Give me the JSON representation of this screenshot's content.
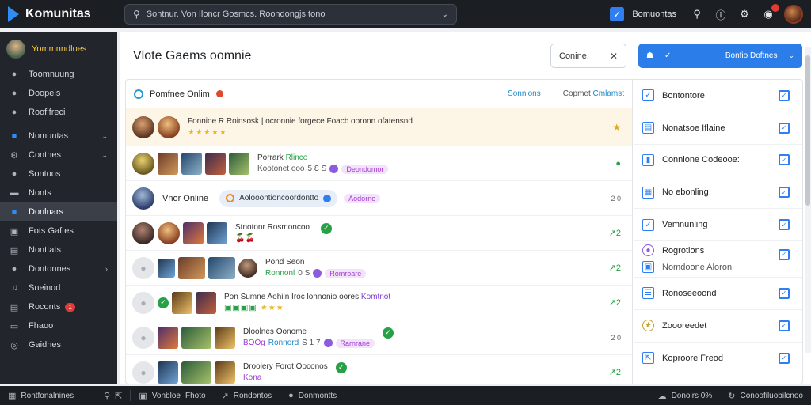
{
  "app": {
    "name": "Komunitas"
  },
  "search": {
    "text": "Sontnur. Von Iloncr Gosmcs. Roondongjs tono"
  },
  "topbar": {
    "checkbox_label": "Bomuontas"
  },
  "sidebar": {
    "user": "Yommnndloes",
    "items": [
      {
        "label": "Toomnuung",
        "icon": "home-icon"
      },
      {
        "label": "Doopeis",
        "icon": "chat-icon"
      },
      {
        "label": "Roofifreci",
        "icon": "person-icon"
      },
      {
        "label": "Nomuntas",
        "icon": "community-icon",
        "chevron": true,
        "accent": true
      },
      {
        "label": "Contnes",
        "icon": "gear-icon",
        "chevron": true
      },
      {
        "label": "Sontoos",
        "icon": "wrench-icon"
      },
      {
        "label": "Nonts",
        "icon": "notes-icon"
      },
      {
        "label": "Donlnars",
        "icon": "group-icon",
        "active": true
      },
      {
        "label": "Fots Gaftes",
        "icon": "image-icon"
      },
      {
        "label": "Nonttats",
        "icon": "doc-icon"
      },
      {
        "label": "Dontonnes",
        "icon": "phone-icon",
        "chevron": true
      },
      {
        "label": "Sneinod",
        "icon": "music-icon"
      },
      {
        "label": "Roconts",
        "icon": "folder-icon",
        "badge": "1"
      },
      {
        "label": "Fhaoo",
        "icon": "card-icon"
      },
      {
        "label": "Gaidnes",
        "icon": "compass-icon"
      }
    ]
  },
  "main": {
    "title": "Vlote Gaems oomnie",
    "filter": {
      "value": "Conine."
    },
    "primary_button": {
      "label": "Bonfio Doftnes"
    },
    "panel": {
      "title": "Pomfnee Onlim",
      "tab_1": "Sonnions",
      "tab_2_prefix": "Copmet",
      "tab_2_suffix": "Cmlamst"
    },
    "rows": [
      {
        "line1": "Fonnioe R Roinsosk | ocronnie forgece Foacb ooronn ofatensnd",
        "stars": "★★★★★",
        "right": "★"
      },
      {
        "line1": "Porrark",
        "line1_green": "Rlinco",
        "line2": "Kootonet ooo",
        "line2_num": "5 Ɛ S",
        "pill": "Deondomor",
        "right": "●"
      },
      {
        "name": "Vnor Online",
        "status": "Aolooontioncoordontto",
        "pill": "Aodorne",
        "right": "2 0"
      },
      {
        "line1": "Stnotonr Rosmoncoo",
        "line2": "🍒🍒",
        "right": "↗2"
      },
      {
        "line1": "Pond Seon",
        "line2": "Ronnonl",
        "line2_num": "0 S",
        "pill": "Romroare",
        "right": "↗2"
      },
      {
        "line1": "Pon Sumne  Aohiln Iroc lonnonio oores",
        "line1_purple": "Komtnot",
        "line2": "▣▣▣▣",
        "stars": "★★★",
        "right": "↗2"
      },
      {
        "line1": "Dloolnes Oonome",
        "line2": "BOOg",
        "line2_link": "Ronnord",
        "line2_num": "S 1 7",
        "pill": "Rarnrane",
        "right": "2 0"
      },
      {
        "line1": "Droolery  Forot Ooconos",
        "line2": "Kona",
        "right": "↗2"
      }
    ],
    "right_list": [
      {
        "label": "Bontontore",
        "icon": "check-icon"
      },
      {
        "label": "Nonatsoe Iflaine",
        "icon": "chart-icon"
      },
      {
        "label": "Connione Codeooe:",
        "icon": "bookmark-icon"
      },
      {
        "label": "No ebonling",
        "icon": "calendar-icon"
      },
      {
        "label": "Vemnunling",
        "icon": "check-icon"
      },
      {
        "label": "Rogrotions",
        "sub": "Nomdoone Aloron",
        "icon": "globe-icon"
      },
      {
        "label": "Ronoseeoond",
        "icon": "list-icon"
      },
      {
        "label": "Zoooreedet",
        "icon": "trophy-icon"
      },
      {
        "label": "Koproore Freod",
        "icon": "share-icon"
      }
    ]
  },
  "bottombar": {
    "left": "Rontfonalnines",
    "item_2": "Vonbloe",
    "item_2_b": "Fhoto",
    "item_3": "Rondontos",
    "item_4": "Donmontts",
    "right_1": "Donoirs 0%",
    "right_2": "Conoofiluobilcnoo"
  }
}
